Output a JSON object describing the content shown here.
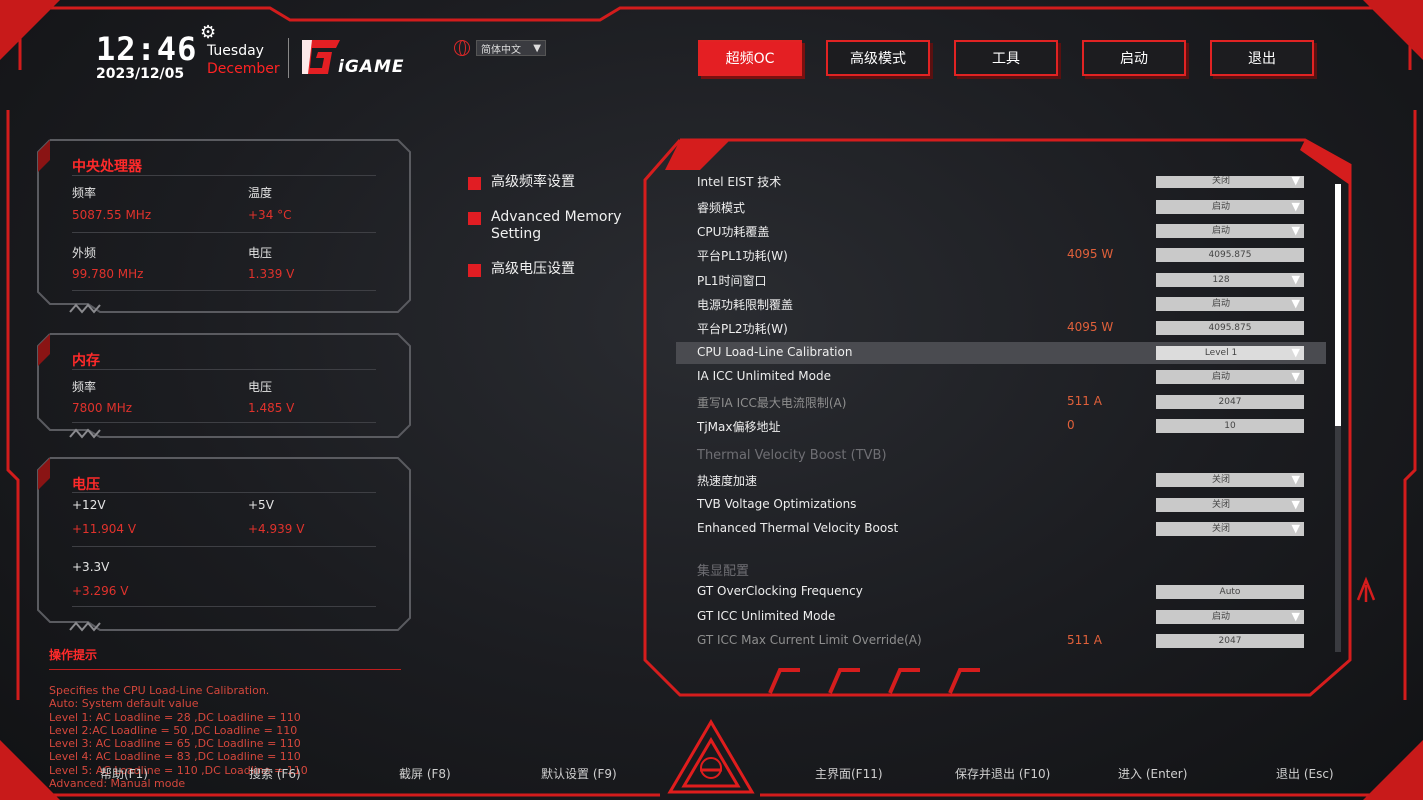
{
  "clock": {
    "time": "12:46",
    "date": "2023/12/05",
    "day": "Tuesday",
    "month": "December"
  },
  "brand": {
    "logo_text": "iGAME"
  },
  "language": {
    "selected": "简体中文"
  },
  "topnav": {
    "tabs": [
      {
        "label": "超频OC",
        "active": true
      },
      {
        "label": "高级模式",
        "active": false
      },
      {
        "label": "工具",
        "active": false
      },
      {
        "label": "启动",
        "active": false
      },
      {
        "label": "退出",
        "active": false
      }
    ]
  },
  "cpu_panel": {
    "title": "中央处理器",
    "freq_label": "频率",
    "freq_value": "5087.55 MHz",
    "temp_label": "温度",
    "temp_value": "+34 °C",
    "bclk_label": "外频",
    "bclk_value": "99.780 MHz",
    "volt_label": "电压",
    "volt_value": "1.339 V"
  },
  "mem_panel": {
    "title": "内存",
    "freq_label": "频率",
    "freq_value": "7800 MHz",
    "volt_label": "电压",
    "volt_value": "1.485 V"
  },
  "volt_panel": {
    "title": "电压",
    "v12_label": "+12V",
    "v12_value": "+11.904 V",
    "v5_label": "+5V",
    "v5_value": "+4.939 V",
    "v33_label": "+3.3V",
    "v33_value": "+3.296 V"
  },
  "menu": {
    "items": [
      {
        "label": "高级频率设置"
      },
      {
        "label": "Advanced Memory Setting"
      },
      {
        "label": "高级电压设置"
      }
    ]
  },
  "settings": {
    "rows": [
      {
        "name": "Intel EIST 技术",
        "value": "",
        "control": "关闭",
        "dropdown": true,
        "dim": false
      },
      {
        "name": "睿频模式",
        "value": "",
        "control": "启动",
        "dropdown": true,
        "dim": false
      },
      {
        "name": "CPU功耗覆盖",
        "value": "",
        "control": "启动",
        "dropdown": true,
        "dim": false
      },
      {
        "name": "平台PL1功耗(W)",
        "value": "4095 W",
        "control": "4095.875",
        "dropdown": false,
        "dim": false
      },
      {
        "name": "PL1时间窗口",
        "value": "",
        "control": "128",
        "dropdown": true,
        "dim": false
      },
      {
        "name": "电源功耗限制覆盖",
        "value": "",
        "control": "启动",
        "dropdown": true,
        "dim": false
      },
      {
        "name": "平台PL2功耗(W)",
        "value": "4095 W",
        "control": "4095.875",
        "dropdown": false,
        "dim": false
      },
      {
        "name": "CPU Load-Line Calibration",
        "value": "",
        "control": "Level 1",
        "dropdown": true,
        "dim": false,
        "highlight": true
      },
      {
        "name": "IA ICC Unlimited Mode",
        "value": "",
        "control": "启动",
        "dropdown": true,
        "dim": false
      },
      {
        "name": "重写IA ICC最大电流限制(A)",
        "value": "511 A",
        "control": "2047",
        "dropdown": false,
        "dim": true
      },
      {
        "name": "TjMax偏移地址",
        "value": "0",
        "control": "10",
        "dropdown": false,
        "dim": false
      }
    ],
    "group1": "Thermal Velocity Boost (TVB)",
    "rows2": [
      {
        "name": "热速度加速",
        "value": "",
        "control": "关闭",
        "dropdown": true,
        "dim": false
      },
      {
        "name": "TVB Voltage Optimizations",
        "value": "",
        "control": "关闭",
        "dropdown": true,
        "dim": false
      },
      {
        "name": "Enhanced Thermal Velocity Boost",
        "value": "",
        "control": "关闭",
        "dropdown": true,
        "dim": false
      }
    ],
    "group2": "集显配置",
    "rows3": [
      {
        "name": "GT OverClocking Frequency",
        "value": "",
        "control": "Auto",
        "dropdown": false,
        "dim": false
      },
      {
        "name": "GT ICC Unlimited Mode",
        "value": "",
        "control": "启动",
        "dropdown": true,
        "dim": false
      },
      {
        "name": "GT ICC Max Current Limit Override(A)",
        "value": "511 A",
        "control": "2047",
        "dropdown": false,
        "dim": true
      }
    ]
  },
  "help": {
    "title": "操作提示",
    "lines": [
      "Specifies the CPU Load-Line Calibration.",
      "Auto: System default value",
      "Level 1: AC Loadline = 28 ,DC Loadline = 110",
      "Level 2:AC Loadline = 50 ,DC Loadline = 110",
      "Level 3: AC Loadline = 65 ,DC Loadline = 110",
      "Level 4: AC Loadline = 83 ,DC Loadline = 110",
      "Level 5: AC Loadline = 110 ,DC Loadline = 110",
      "Advanced: Manual mode"
    ]
  },
  "footer": {
    "help_key": "帮助(F1)",
    "search_key": "搜索 (F6)",
    "screenshot_key": "截屏 (F8)",
    "defaults_key": "默认设置 (F9)",
    "main_key": "主界面(F11)",
    "save_exit_key": "保存并退出 (F10)",
    "enter_key": "进入 (Enter)",
    "exit_key": "退出 (Esc)"
  }
}
